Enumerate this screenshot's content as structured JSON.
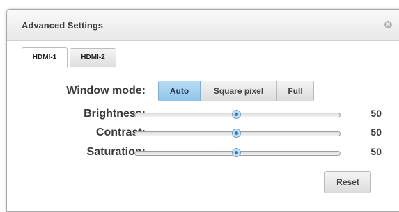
{
  "dialog": {
    "title": "Advanced Settings",
    "close_icon": "close-icon"
  },
  "tabs": [
    {
      "label": "HDMI-1",
      "active": true
    },
    {
      "label": "HDMI-2",
      "active": false
    }
  ],
  "window_mode": {
    "label": "Window mode:",
    "options": [
      "Auto",
      "Square pixel",
      "Full"
    ],
    "selected": "Auto"
  },
  "sliders": [
    {
      "label": "Brightness:",
      "value": "50",
      "fraction": 0.5
    },
    {
      "label": "Contrast:",
      "value": "50",
      "fraction": 0.5
    },
    {
      "label": "Saturation:",
      "value": "50",
      "fraction": 0.5
    }
  ],
  "reset_label": "Reset",
  "colors": {
    "selected_accent": "#8ec3e8",
    "thumb": "#2f78b4"
  }
}
